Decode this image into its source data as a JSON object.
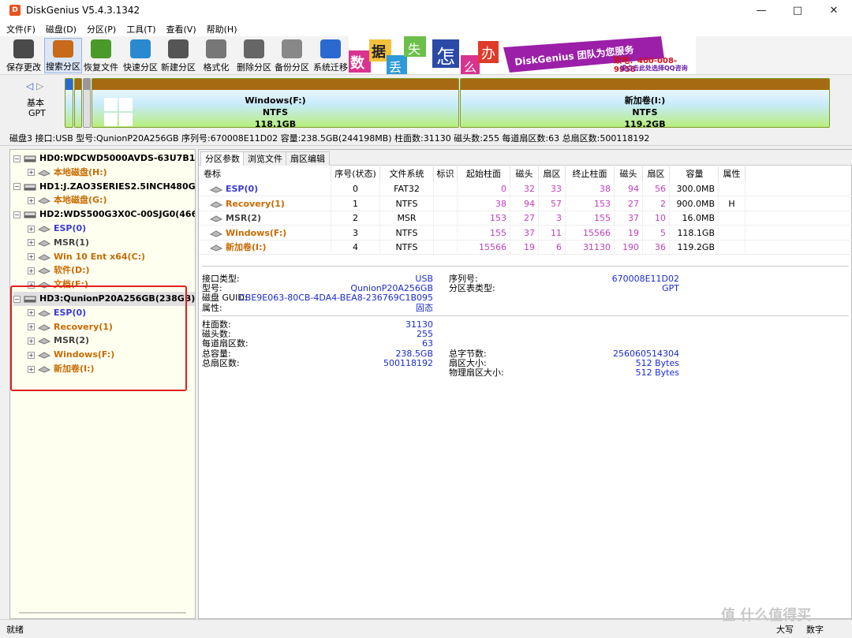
{
  "window": {
    "title": "DiskGenius V5.4.3.1342",
    "app_icon_letter": "D",
    "minimize_glyph": "—",
    "maximize_glyph": "□",
    "close_glyph": "✕"
  },
  "menu": [
    "文件(F)",
    "磁盘(D)",
    "分区(P)",
    "工具(T)",
    "查看(V)",
    "帮助(H)"
  ],
  "toolbar": [
    {
      "label": "保存更改",
      "icon": "save-icon",
      "color": "#4a4a4a"
    },
    {
      "label": "搜索分区",
      "icon": "search-icon",
      "color": "#c76a1a",
      "active": true
    },
    {
      "label": "恢复文件",
      "icon": "recover-icon",
      "color": "#4a9a2a"
    },
    {
      "label": "快速分区",
      "icon": "quick-partition-icon",
      "color": "#2a8ad0"
    },
    {
      "label": "新建分区",
      "icon": "new-partition-icon",
      "color": "#555555"
    },
    {
      "label": "格式化",
      "icon": "format-icon",
      "color": "#777777"
    },
    {
      "label": "删除分区",
      "icon": "delete-icon",
      "color": "#666666"
    },
    {
      "label": "备份分区",
      "icon": "backup-icon",
      "color": "#888888"
    },
    {
      "label": "系统迁移",
      "icon": "migrate-icon",
      "color": "#2a6ad0"
    }
  ],
  "ad": {
    "chars": [
      "数",
      "据",
      "丢",
      "失",
      "怎",
      "么",
      "办"
    ],
    "brand": "DiskGenius 团队为您服务",
    "phone": "致电：400-008-9958",
    "qq": "或点击此处选择QQ咨询"
  },
  "diskmap": {
    "nav_left": "◁",
    "nav_right": "▷",
    "disk_type_1": "基本",
    "disk_type_2": "GPT",
    "partitions": [
      {
        "name": "Windows(F:)",
        "fs": "NTFS",
        "size": "118.1GB"
      },
      {
        "name": "新加卷(I:)",
        "fs": "NTFS",
        "size": "119.2GB"
      }
    ]
  },
  "disk_info_line": "磁盘3 接口:USB  型号:QunionP20A256GB  序列号:670008E11D02  容量:238.5GB(244198MB)  柱面数:31130  磁头数:255  每道扇区数:63  总扇区数:500118192",
  "tree": [
    {
      "label": "HD0:WDCWD5000AVDS-63U7B1(466",
      "kind": "disk",
      "level": 0
    },
    {
      "label": "本地磁盘(H:)",
      "kind": "orange",
      "level": 1
    },
    {
      "label": "HD1:J.ZAO3SERIES2.5INCH480GBSAT",
      "kind": "disk",
      "level": 0
    },
    {
      "label": "本地磁盘(G:)",
      "kind": "orange",
      "level": 1
    },
    {
      "label": "HD2:WDS500G3X0C-00SJG0(466GB)",
      "kind": "disk",
      "level": 0
    },
    {
      "label": "ESP(0)",
      "kind": "blue",
      "level": 1
    },
    {
      "label": "MSR(1)",
      "kind": "gray",
      "level": 1
    },
    {
      "label": "Win 10 Ent x64(C:)",
      "kind": "orange",
      "level": 1
    },
    {
      "label": "软件(D:)",
      "kind": "orange",
      "level": 1
    },
    {
      "label": "文档(E:)",
      "kind": "orange",
      "level": 1
    },
    {
      "label": "HD3:QunionP20A256GB(238GB)",
      "kind": "disk",
      "level": 0,
      "selected": true
    },
    {
      "label": "ESP(0)",
      "kind": "blue",
      "level": 1
    },
    {
      "label": "Recovery(1)",
      "kind": "orange",
      "level": 1
    },
    {
      "label": "MSR(2)",
      "kind": "gray",
      "level": 1
    },
    {
      "label": "Windows(F:)",
      "kind": "orange",
      "level": 1
    },
    {
      "label": "新加卷(I:)",
      "kind": "orange",
      "level": 1
    }
  ],
  "tabs": [
    "分区参数",
    "浏览文件",
    "扇区编辑"
  ],
  "table": {
    "headers": [
      "卷标",
      "序号(状态)",
      "文件系统",
      "标识",
      "起始柱面",
      "磁头",
      "扇区",
      "终止柱面",
      "磁头",
      "扇区",
      "容量",
      "属性"
    ],
    "rows": [
      {
        "label": "ESP(0)",
        "kind": "blue",
        "cells": [
          "0",
          "FAT32",
          "",
          "0",
          "32",
          "33",
          "38",
          "94",
          "56",
          "300.0MB",
          ""
        ]
      },
      {
        "label": "Recovery(1)",
        "kind": "orange",
        "cells": [
          "1",
          "NTFS",
          "",
          "38",
          "94",
          "57",
          "153",
          "27",
          "2",
          "900.0MB",
          "H"
        ]
      },
      {
        "label": "MSR(2)",
        "kind": "gray",
        "cells": [
          "2",
          "MSR",
          "",
          "153",
          "27",
          "3",
          "155",
          "37",
          "10",
          "16.0MB",
          ""
        ]
      },
      {
        "label": "Windows(F:)",
        "kind": "orange",
        "cells": [
          "3",
          "NTFS",
          "",
          "155",
          "37",
          "11",
          "15566",
          "19",
          "5",
          "118.1GB",
          ""
        ]
      },
      {
        "label": "新加卷(I:)",
        "kind": "orange",
        "cells": [
          "4",
          "NTFS",
          "",
          "15566",
          "19",
          "6",
          "31130",
          "190",
          "36",
          "119.2GB",
          ""
        ]
      }
    ]
  },
  "details": {
    "block1": [
      {
        "k": "接口类型:",
        "v": "USB",
        "k2": "序列号:",
        "v2": "670008E11D02"
      },
      {
        "k": "型号:",
        "v": "QunionP20A256GB",
        "k2": "分区表类型:",
        "v2": "GPT"
      },
      {
        "k": "磁盘 GUID:",
        "v": "CBE9E063-80CB-4DA4-BEA8-236769C1B095",
        "k2": "",
        "v2": ""
      },
      {
        "k": "属性:",
        "v": "固态",
        "k2": "",
        "v2": ""
      }
    ],
    "block2": [
      {
        "k": "柱面数:",
        "v": "31130",
        "k2": "",
        "v2": ""
      },
      {
        "k": "磁头数:",
        "v": "255",
        "k2": "",
        "v2": ""
      },
      {
        "k": "每道扇区数:",
        "v": "63",
        "k2": "",
        "v2": ""
      },
      {
        "k": "总容量:",
        "v": "238.5GB",
        "k2": "总字节数:",
        "v2": "256060514304"
      },
      {
        "k": "总扇区数:",
        "v": "500118192",
        "k2": "扇区大小:",
        "v2": "512 Bytes"
      },
      {
        "k": "",
        "v": "",
        "k2": "物理扇区大小:",
        "v2": "512 Bytes"
      }
    ]
  },
  "status": {
    "left": "就绪",
    "caps": "大写",
    "num": "数字"
  },
  "watermark": "值 什么值得买"
}
